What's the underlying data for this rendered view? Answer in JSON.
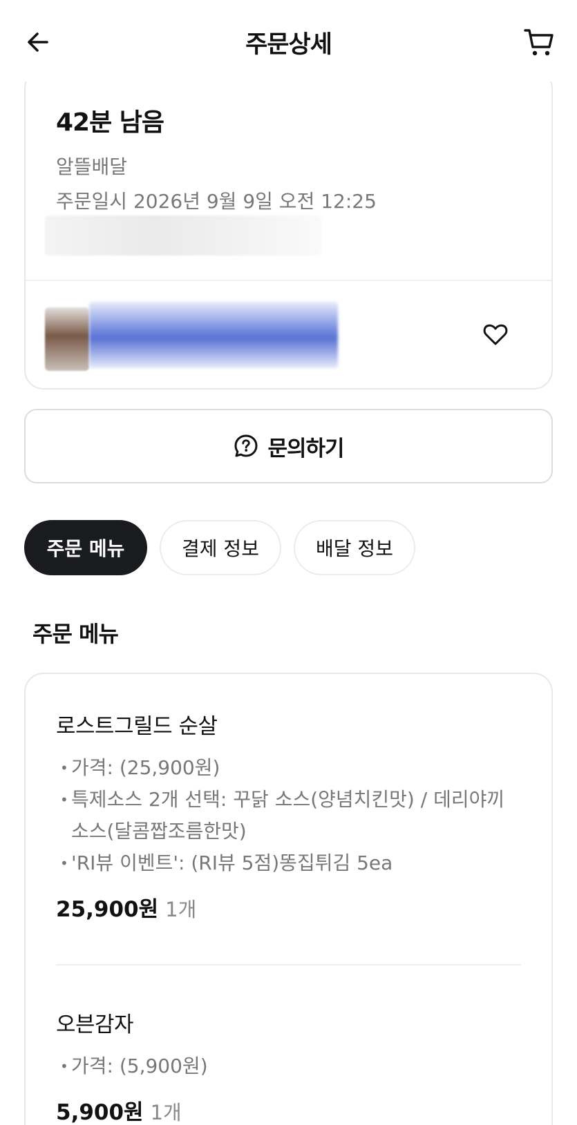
{
  "header": {
    "title": "주문상세",
    "back_icon": "arrow-left-icon",
    "cart_icon": "cart-icon"
  },
  "status": {
    "time_left": "42분 남음",
    "delivery_type": "알뜰배달",
    "order_datetime": "주문일시 2026년 9월 9일 오전 12:25",
    "favorite_icon": "heart-icon"
  },
  "inquiry": {
    "label": "문의하기",
    "icon": "question-bubble-icon"
  },
  "tabs": [
    {
      "label": "주문 메뉴",
      "active": true
    },
    {
      "label": "결제 정보",
      "active": false
    },
    {
      "label": "배달 정보",
      "active": false
    }
  ],
  "order_menu": {
    "section_title": "주문 메뉴",
    "items": [
      {
        "name": "로스트그릴드 순살",
        "options": [
          "가격:  (25,900원)",
          "특제소스 2개 선택: 꾸닭 소스(양념치킨맛)  / 데리야끼 소스(달콤짭조름한맛)",
          "'RI뷰 이벤트': (RI뷰 5점)똥집튀김 5ea"
        ],
        "price": "25,900원",
        "qty": "1개"
      },
      {
        "name": "오븐감자",
        "options": [
          "가격:  (5,900원)"
        ],
        "price": "5,900원",
        "qty": "1개"
      }
    ]
  }
}
